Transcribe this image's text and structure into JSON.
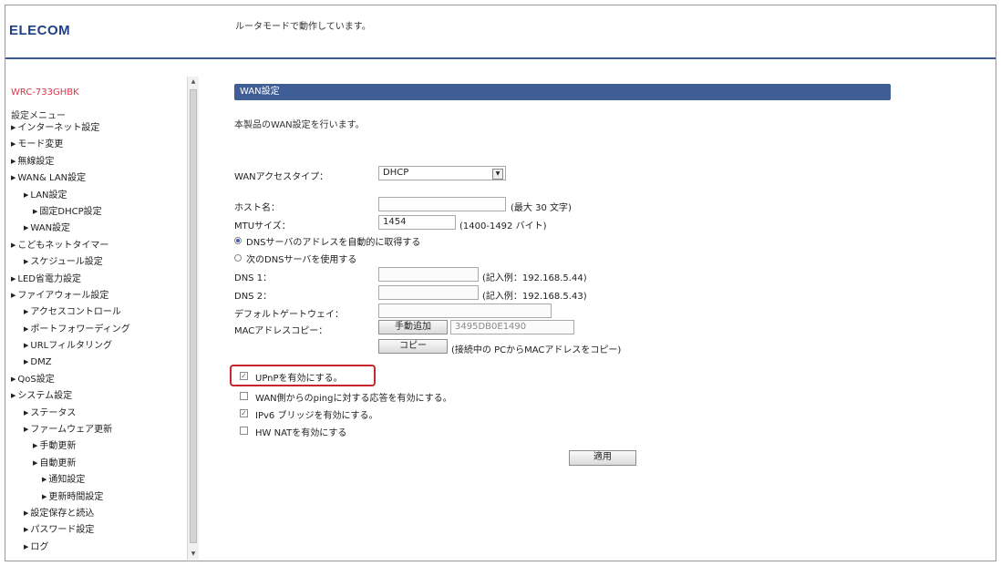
{
  "header": {
    "logo": "ELECOM",
    "status_message": "ルータモードで動作しています。"
  },
  "sidebar": {
    "model": "WRC-733GHBK",
    "menu_title": "設定メニュー",
    "items": [
      {
        "label": "インターネット設定",
        "level": 0
      },
      {
        "label": "モード変更",
        "level": 0
      },
      {
        "label": "無線設定",
        "level": 0
      },
      {
        "label": "WAN& LAN設定",
        "level": 0
      },
      {
        "label": "LAN設定",
        "level": 1
      },
      {
        "label": "固定DHCP設定",
        "level": 2
      },
      {
        "label": "WAN設定",
        "level": 1
      },
      {
        "label": "こどもネットタイマー",
        "level": 0
      },
      {
        "label": "スケジュール設定",
        "level": 1
      },
      {
        "label": "LED省電力設定",
        "level": 0
      },
      {
        "label": "ファイアウォール設定",
        "level": 0
      },
      {
        "label": "アクセスコントロール",
        "level": 1
      },
      {
        "label": "ポートフォワーディング",
        "level": 1
      },
      {
        "label": "URLフィルタリング",
        "level": 1
      },
      {
        "label": "DMZ",
        "level": 1
      },
      {
        "label": "QoS設定",
        "level": 0
      },
      {
        "label": "システム設定",
        "level": 0
      },
      {
        "label": "ステータス",
        "level": 1
      },
      {
        "label": "ファームウェア更新",
        "level": 1
      },
      {
        "label": "手動更新",
        "level": 2
      },
      {
        "label": "自動更新",
        "level": 2
      },
      {
        "label": "通知設定",
        "level": 3
      },
      {
        "label": "更新時間設定",
        "level": 3
      },
      {
        "label": "設定保存と読込",
        "level": 1
      },
      {
        "label": "パスワード設定",
        "level": 1
      },
      {
        "label": "ログ",
        "level": 1
      }
    ]
  },
  "main": {
    "section_title": "WAN設定",
    "description": "本製品のWAN設定を行います。",
    "wan_access_type": {
      "label": "WANアクセスタイプ：",
      "value": "DHCP"
    },
    "hostname": {
      "label": "ホスト名：",
      "value": "",
      "hint": "(最大 30 文字)"
    },
    "mtu": {
      "label": "MTUサイズ：",
      "value": "1454",
      "hint": "(1400-1492 バイト)"
    },
    "dns_auto": {
      "label": "DNSサーバのアドレスを自動的に取得する",
      "selected": true
    },
    "dns_manual": {
      "label": "次のDNSサーバを使用する",
      "selected": false
    },
    "dns1": {
      "label": "DNS 1：",
      "value": "",
      "hint": "(記入例：192.168.5.44)"
    },
    "dns2": {
      "label": "DNS 2：",
      "value": "",
      "hint": "(記入例：192.168.5.43)"
    },
    "gateway": {
      "label": "デフォルトゲートウェイ：",
      "value": ""
    },
    "mac": {
      "label": "MACアドレスコピー：",
      "manual_button": "手動追加",
      "value": "3495DB0E1490",
      "copy_button": "コピー",
      "copy_hint": "(接続中の PCからMACアドレスをコピー)"
    },
    "options": [
      {
        "label": "UPnPを有効にする。",
        "checked": true
      },
      {
        "label": "WAN側からのpingに対する応答を有効にする。",
        "checked": false
      },
      {
        "label": "IPv6 ブリッジを有効にする。",
        "checked": true
      },
      {
        "label": "HW NATを有効にする",
        "checked": false
      }
    ],
    "apply_button": "適用"
  },
  "colors": {
    "brand": "#1f3f86",
    "section_bar": "#3e5e95",
    "model_text": "#d9334b",
    "highlight": "#c6262e"
  }
}
